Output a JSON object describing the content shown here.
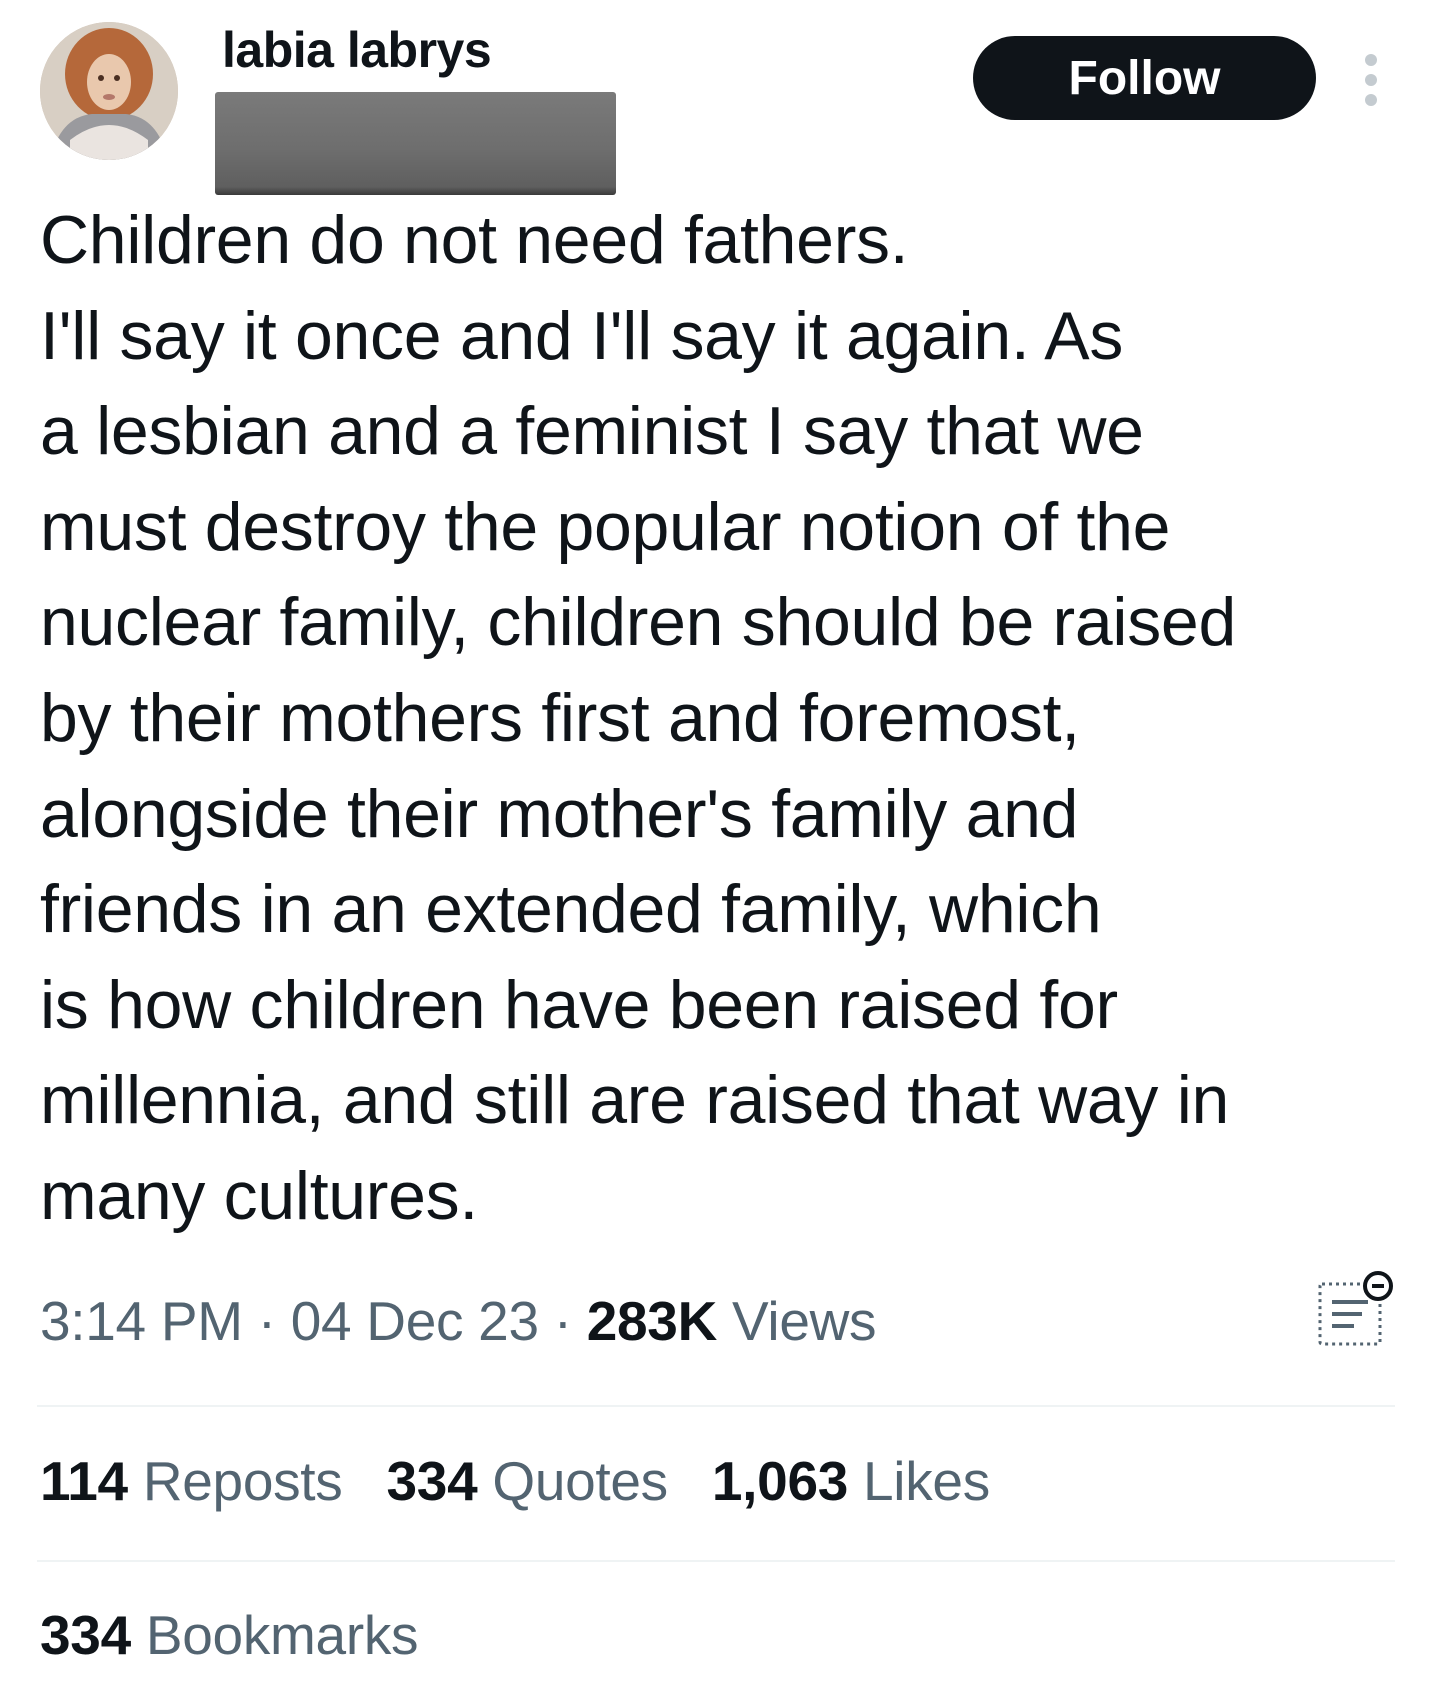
{
  "author": {
    "display_name": "labia labrys",
    "avatar_icon": "profile-photo"
  },
  "header": {
    "follow_label": "Follow",
    "more_icon": "more-vertical-icon"
  },
  "tweet": {
    "lines": [
      "Children do not need fathers.",
      "I'll say it once and I'll say it again. As",
      "a lesbian and a feminist I say that we",
      "must destroy the popular notion of the",
      "nuclear family, children should be raised",
      "by their mothers first and foremost,",
      "alongside their mother's family and",
      "friends in an extended family, which",
      "is how children have been raised for",
      "millennia, and still are raised that way in",
      "many cultures."
    ]
  },
  "meta": {
    "time": "3:14 PM",
    "separator": " · ",
    "date": "04 Dec 23",
    "views_count": "283K",
    "views_label": " Views",
    "analytics_icon": "post-analytics-icon"
  },
  "stats": {
    "reposts_count": "114",
    "reposts_label": " Reposts",
    "quotes_count": "334",
    "quotes_label": " Quotes",
    "likes_count": "1,063",
    "likes_label": " Likes",
    "bookmarks_count": "334",
    "bookmarks_label": " Bookmarks"
  },
  "colors": {
    "text_primary": "#0f1419",
    "text_secondary": "#536471",
    "divider": "#eff3f4",
    "follow_bg": "#0f1419"
  }
}
